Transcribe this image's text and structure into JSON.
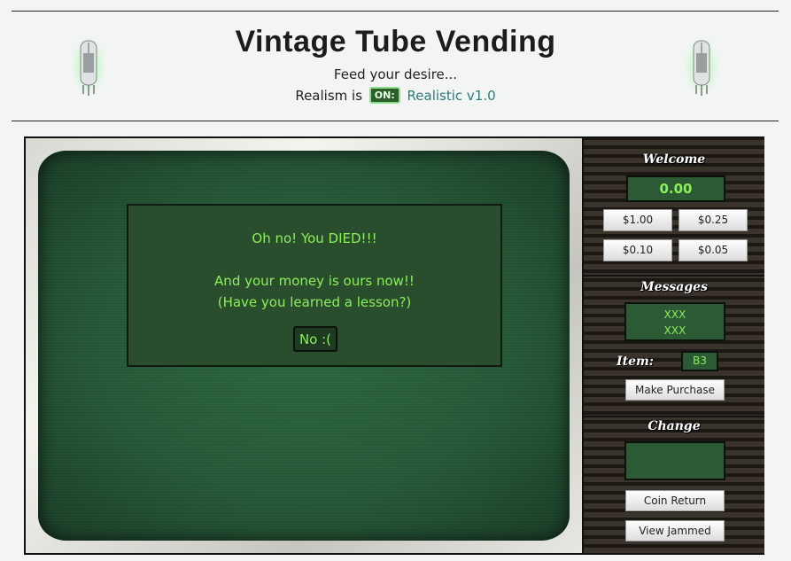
{
  "header": {
    "title": "Vintage Tube Vending",
    "tagline": "Feed your desire...",
    "realism_prefix": "Realism is",
    "realism_badge": "ON:",
    "realism_link": "Realistic v1.0"
  },
  "screen": {
    "dialog": {
      "line1": "Oh no! You DIED!!!",
      "line2": "And your money is ours now!!",
      "line3": "(Have you learned a lesson?)",
      "button": "No :("
    }
  },
  "panel": {
    "welcome_label": "Welcome",
    "balance": "0.00",
    "coins": [
      "$1.00",
      "$0.25",
      "$0.10",
      "$0.05"
    ],
    "messages_label": "Messages",
    "messages": [
      "XXX",
      "XXX"
    ],
    "item_label": "Item:",
    "item_value": "B3",
    "make_purchase": "Make Purchase",
    "change_label": "Change",
    "change_value": "",
    "coin_return": "Coin Return",
    "view_jammed": "View Jammed"
  },
  "colors": {
    "screen_green": "#285b3a",
    "display_text": "#8bf05a",
    "link": "#2a7a7a"
  }
}
